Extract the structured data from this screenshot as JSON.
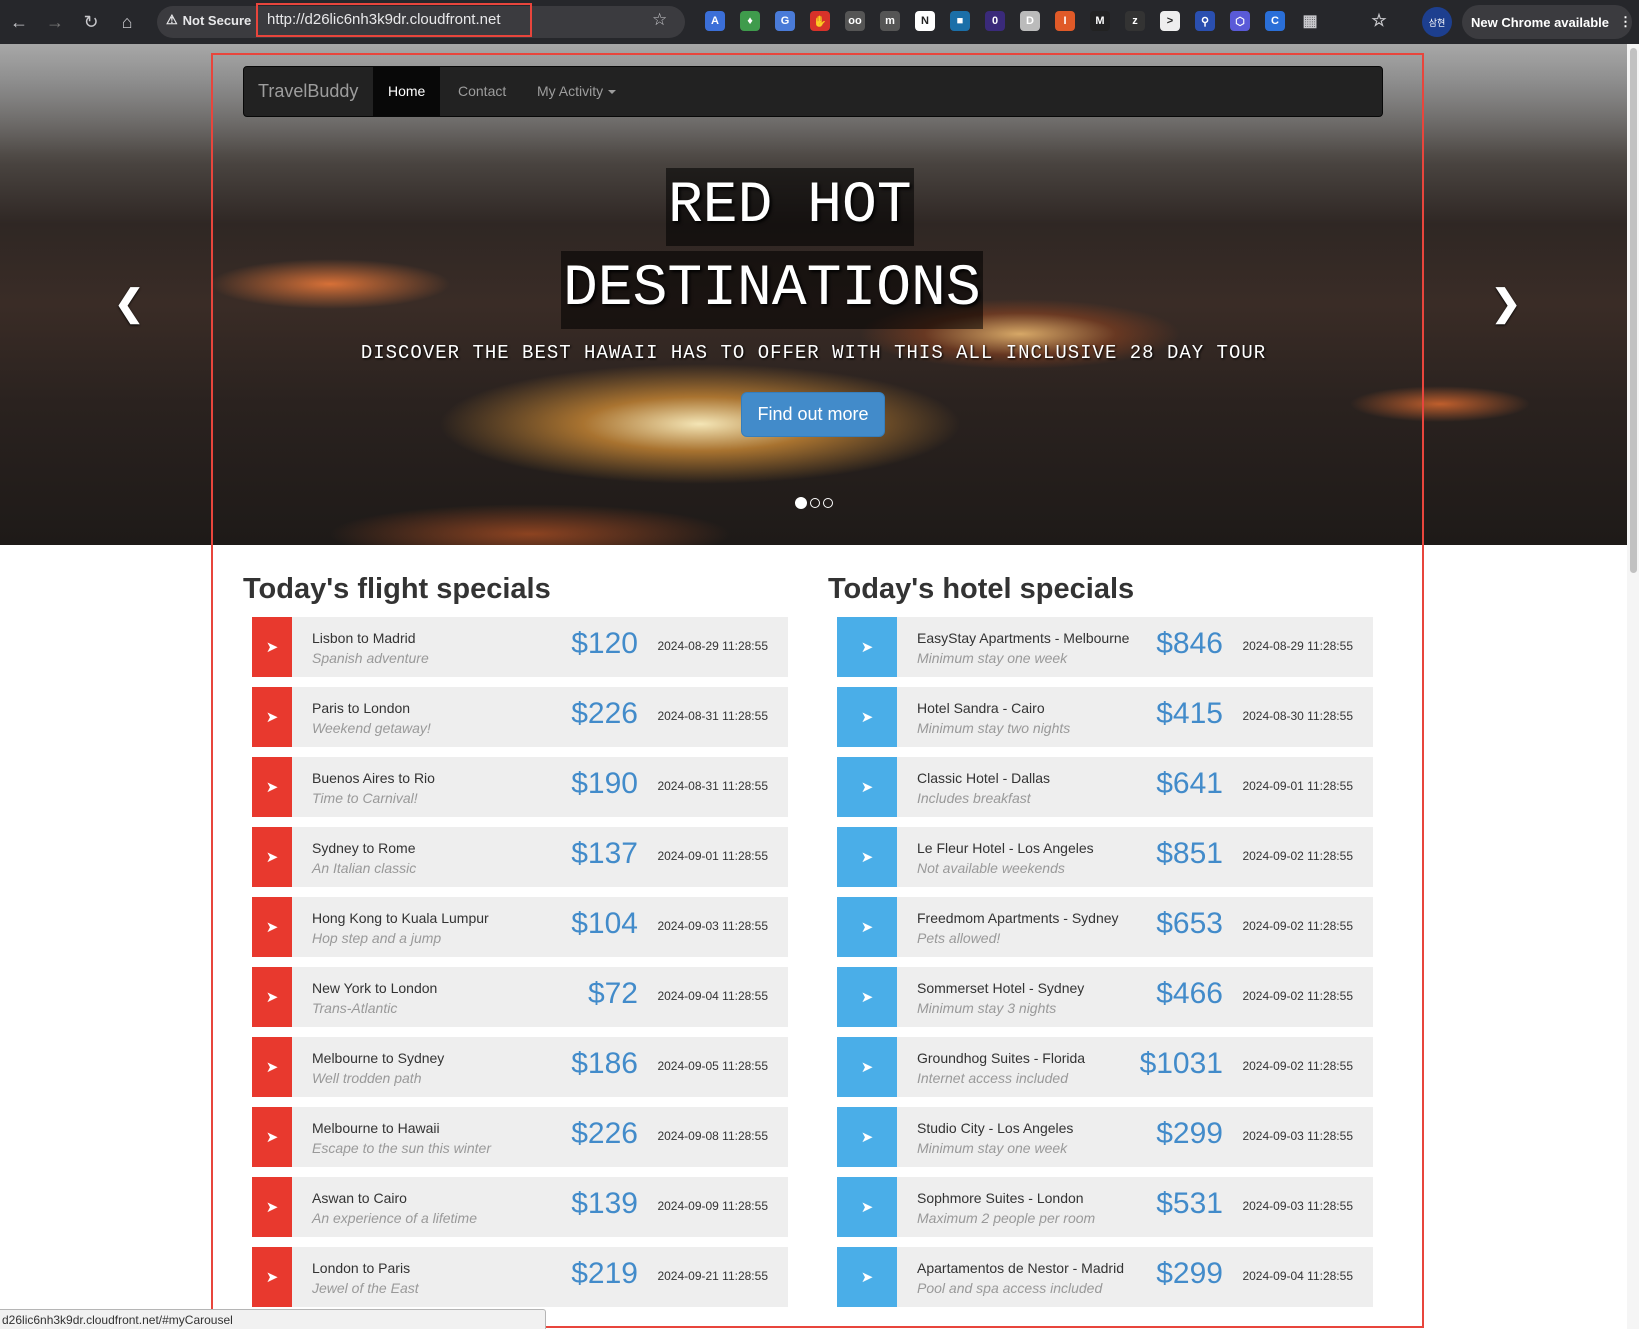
{
  "browser": {
    "security_label": "Not Secure",
    "url": "http://d26lic6nh3k9dr.cloudfront.net",
    "new_chrome_label": "New Chrome available",
    "profile_label": "삼현",
    "status_url": "d26lic6nh3k9dr.cloudfront.net/#myCarousel"
  },
  "navbar": {
    "brand": "TravelBuddy",
    "items": [
      {
        "label": "Home",
        "active": true
      },
      {
        "label": "Contact",
        "active": false
      },
      {
        "label": "My Activity",
        "active": false
      }
    ]
  },
  "hero": {
    "title_line1": "RED HOT",
    "title_line2": "DESTINATIONS",
    "subtitle": "DISCOVER THE BEST HAWAII HAS TO OFFER WITH THIS ALL INCLUSIVE 28 DAY TOUR",
    "button": "Find out more",
    "slides_total": 3,
    "slide_active": 1
  },
  "flights": {
    "title": "Today's flight specials",
    "icon": "plane-icon",
    "items": [
      {
        "name": "Lisbon to Madrid",
        "desc": "Spanish adventure",
        "price": "$120",
        "date": "2024-08-29 11:28:55"
      },
      {
        "name": "Paris to London",
        "desc": "Weekend getaway!",
        "price": "$226",
        "date": "2024-08-31 11:28:55"
      },
      {
        "name": "Buenos Aires to Rio",
        "desc": "Time to Carnival!",
        "price": "$190",
        "date": "2024-08-31 11:28:55"
      },
      {
        "name": "Sydney to Rome",
        "desc": "An Italian classic",
        "price": "$137",
        "date": "2024-09-01 11:28:55"
      },
      {
        "name": "Hong Kong to Kuala Lumpur",
        "desc": "Hop step and a jump",
        "price": "$104",
        "date": "2024-09-03 11:28:55"
      },
      {
        "name": "New York to London",
        "desc": "Trans-Atlantic",
        "price": "$72",
        "date": "2024-09-04 11:28:55"
      },
      {
        "name": "Melbourne to Sydney",
        "desc": "Well trodden path",
        "price": "$186",
        "date": "2024-09-05 11:28:55"
      },
      {
        "name": "Melbourne to Hawaii",
        "desc": "Escape to the sun this winter",
        "price": "$226",
        "date": "2024-09-08 11:28:55"
      },
      {
        "name": "Aswan to Cairo",
        "desc": "An experience of a lifetime",
        "price": "$139",
        "date": "2024-09-09 11:28:55"
      },
      {
        "name": "London to Paris",
        "desc": "Jewel of the East",
        "price": "$219",
        "date": "2024-09-21 11:28:55"
      }
    ]
  },
  "hotels": {
    "title": "Today's hotel specials",
    "icon": "plane-icon",
    "items": [
      {
        "name": "EasyStay Apartments - Melbourne",
        "desc": "Minimum stay one week",
        "price": "$846",
        "date": "2024-08-29 11:28:55"
      },
      {
        "name": "Hotel Sandra - Cairo",
        "desc": "Minimum stay two nights",
        "price": "$415",
        "date": "2024-08-30 11:28:55"
      },
      {
        "name": "Classic Hotel - Dallas",
        "desc": "Includes breakfast",
        "price": "$641",
        "date": "2024-09-01 11:28:55"
      },
      {
        "name": "Le Fleur Hotel - Los Angeles",
        "desc": "Not available weekends",
        "price": "$851",
        "date": "2024-09-02 11:28:55"
      },
      {
        "name": "Freedmom Apartments - Sydney",
        "desc": "Pets allowed!",
        "price": "$653",
        "date": "2024-09-02 11:28:55"
      },
      {
        "name": "Sommerset Hotel - Sydney",
        "desc": "Minimum stay 3 nights",
        "price": "$466",
        "date": "2024-09-02 11:28:55"
      },
      {
        "name": "Groundhog Suites - Florida",
        "desc": "Internet access included",
        "price": "$1031",
        "date": "2024-09-02 11:28:55"
      },
      {
        "name": "Studio City - Los Angeles",
        "desc": "Minimum stay one week",
        "price": "$299",
        "date": "2024-09-03 11:28:55"
      },
      {
        "name": "Sophmore Suites - London",
        "desc": "Maximum 2 people per room",
        "price": "$531",
        "date": "2024-09-03 11:28:55"
      },
      {
        "name": "Apartamentos de Nestor - Madrid",
        "desc": "Pool and spa access included",
        "price": "$299",
        "date": "2024-09-04 11:28:55"
      }
    ]
  },
  "colors": {
    "flight_icon_bg": "#e8392e",
    "hotel_icon_bg": "#4aaee8",
    "price": "#428bca",
    "highlight_frame": "#e8453c"
  }
}
